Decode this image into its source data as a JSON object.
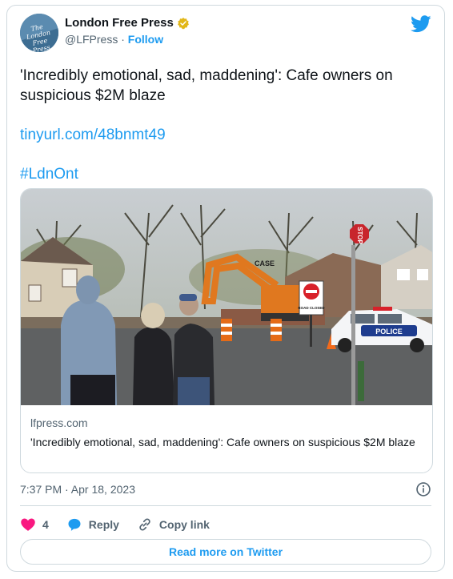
{
  "account": {
    "name": "London Free Press",
    "handle": "@LFPress",
    "separator": "·",
    "follow_label": "Follow",
    "avatar_text": "The London Free Press"
  },
  "tweet": {
    "text": "'Incredibly emotional, sad, maddening': Cafe owners on suspicious $2M blaze",
    "link": "tinyurl.com/48bnmt49",
    "hashtag": "#LdnOnt"
  },
  "media_card": {
    "domain": "lfpress.com",
    "title": "'Incredibly emotional, sad, maddening': Cafe owners on suspicious $2M blaze",
    "photo_sign_text": "ROAD CLOSED",
    "photo_excavator_text": "CASE",
    "photo_police_text": "POLICE",
    "photo_stop_text": "STOP"
  },
  "meta": {
    "timestamp": "7:37 PM · Apr 18, 2023"
  },
  "actions": {
    "like_count": "4",
    "reply_label": "Reply",
    "copy_label": "Copy link"
  },
  "footer": {
    "read_more_label": "Read more on Twitter"
  },
  "colors": {
    "brand_blue": "#1d9bf0",
    "like_red": "#f91880",
    "verified_gold": "#e2b719"
  },
  "icons": [
    "verified-badge-icon",
    "twitter-bird-icon",
    "info-icon",
    "heart-icon",
    "reply-bubble-icon",
    "copy-link-icon"
  ]
}
